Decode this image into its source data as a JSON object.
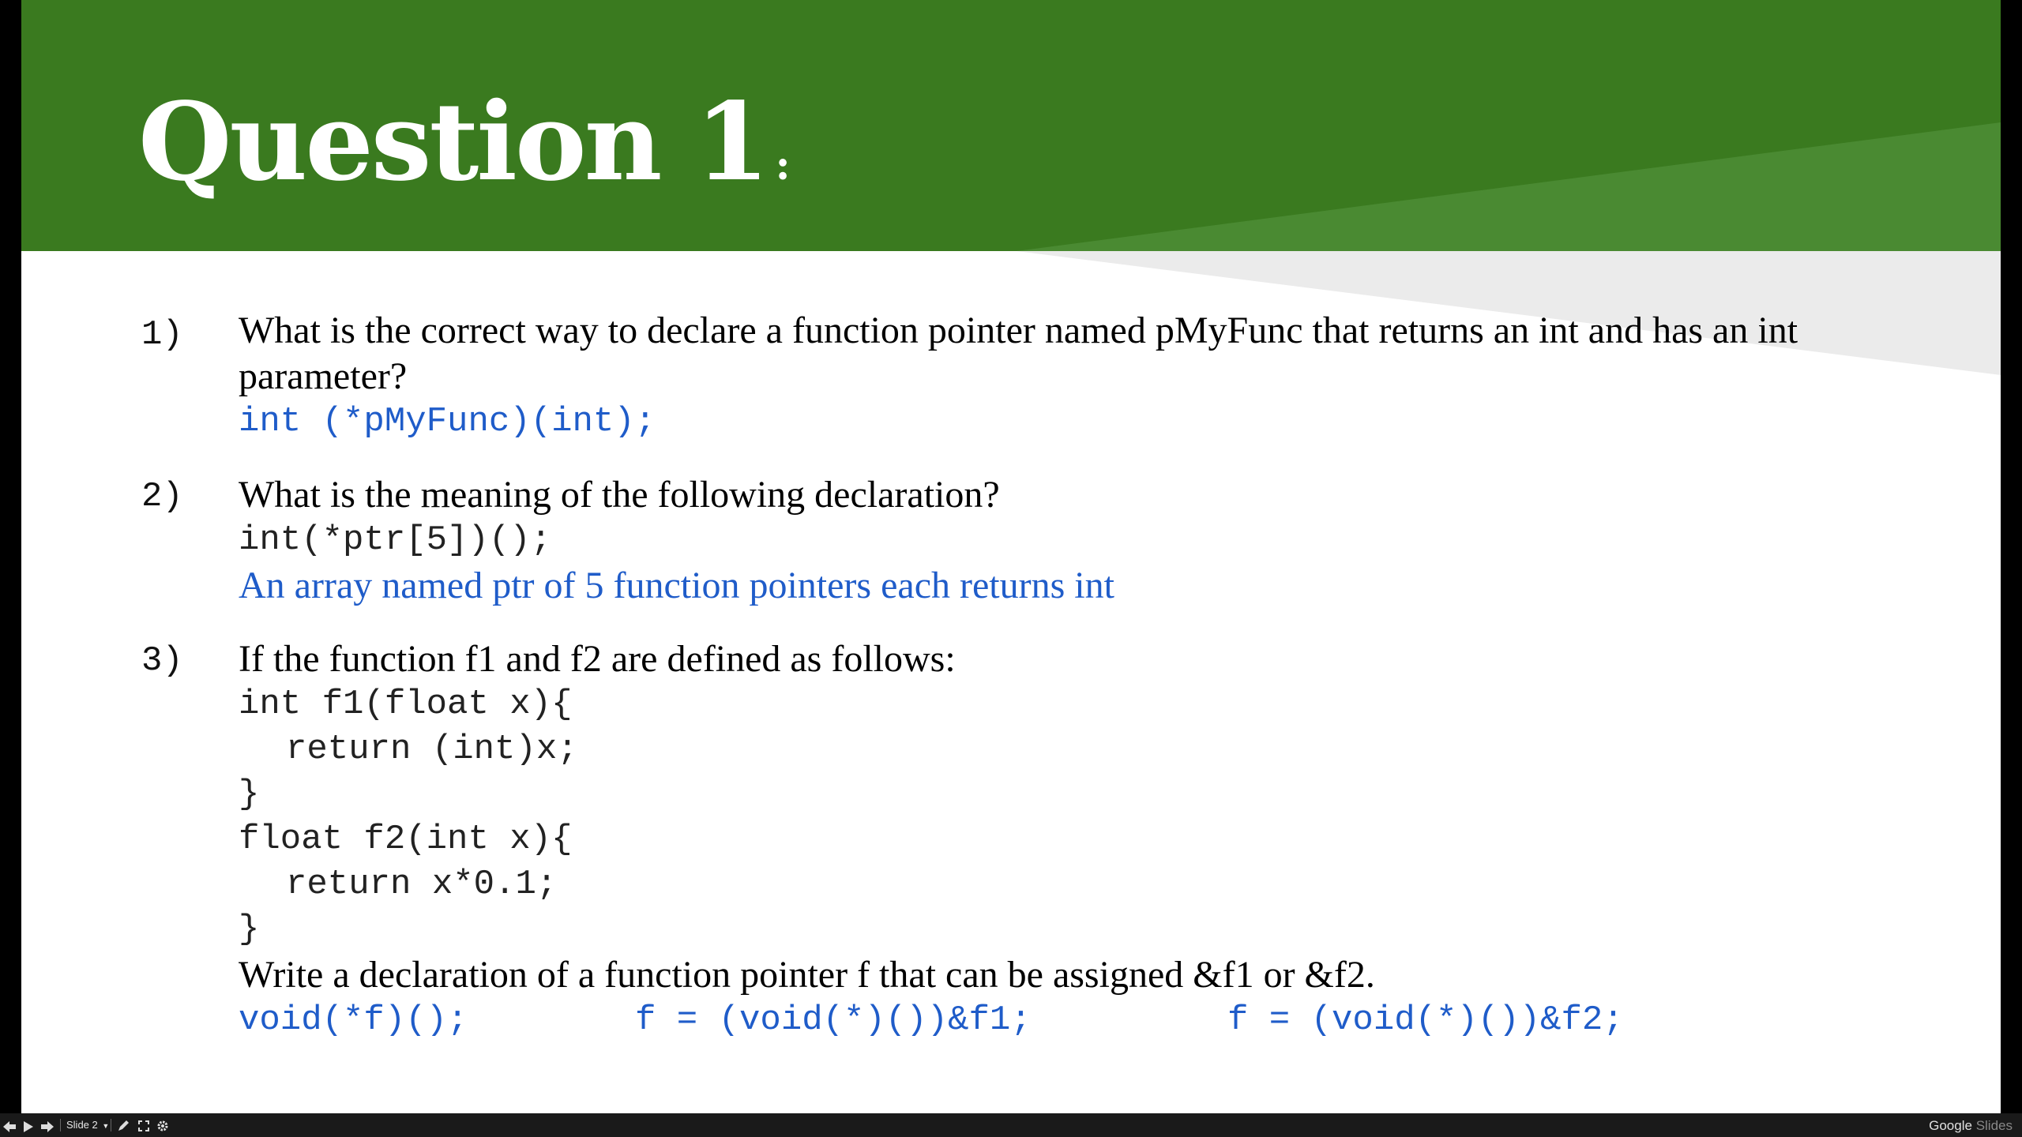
{
  "slide": {
    "title": "Question 1",
    "title_suffix": ":",
    "colors": {
      "header": "#3a7a1f",
      "answer": "#1f5cc9",
      "band": "#ebebeb"
    }
  },
  "questions": [
    {
      "number": "1)",
      "lines": [
        "What is the correct way to declare a function pointer named pMyFunc that returns an int and has an int",
        "parameter?"
      ],
      "answer_code": "int (*pMyFunc)(int);"
    },
    {
      "number": "2)",
      "prompt": "What is the meaning of the following declaration?",
      "code": "int(*ptr[5])();",
      "answer_text": "An array named ptr of 5 function pointers each returns int"
    },
    {
      "number": "3)",
      "prompt": "If the function f1 and f2 are defined as follows:",
      "code_lines": [
        "int f1(float x){",
        "return (int)x;",
        "}",
        "float f2(int x){",
        "return x*0.1;",
        "}"
      ],
      "followup": "Write a declaration of a function pointer f that can be assigned &f1 or &f2.",
      "answer_parts": [
        "void(*f)();",
        "f = (void(*)())&f1;",
        "f = (void(*)())&f2;"
      ]
    }
  ],
  "toolbar": {
    "slide_label": "Slide 2",
    "icons": [
      "prev-icon",
      "play-icon",
      "next-icon",
      "chevron-down-icon",
      "pen-icon",
      "fullscreen-icon",
      "gear-icon"
    ],
    "brand_main": "Google",
    "brand_dim": "Slides"
  }
}
